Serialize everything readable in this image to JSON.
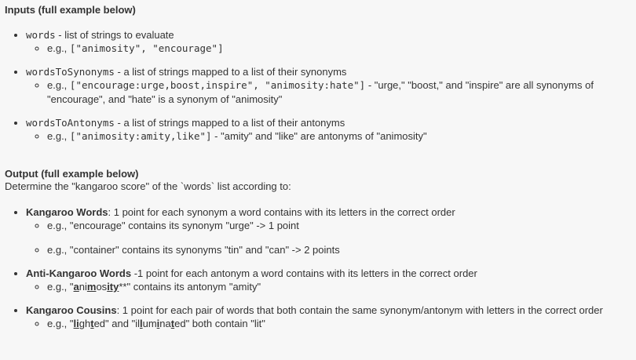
{
  "inputs": {
    "heading": "Inputs (full example below)",
    "items": [
      {
        "code": "words",
        "desc": " - list of strings to evaluate",
        "example_prefix": "e.g., ",
        "example_code": "[\"animosity\", \"encourage\"]",
        "example_suffix": ""
      },
      {
        "code": "wordsToSynonyms",
        "desc": " - a list of strings mapped to a list of their synonyms",
        "example_prefix": "e.g., ",
        "example_code": "[\"encourage:urge,boost,inspire\", \"animosity:hate\"]",
        "example_suffix": " - \"urge,\" \"boost,\" and \"inspire\" are all synonyms of \"encourage\", and \"hate\" is a synonym of \"animosity\""
      },
      {
        "code": "wordsToAntonyms",
        "desc": " - a list of strings mapped to a list of their antonyms",
        "example_prefix": "e.g., ",
        "example_code": "[\"animosity:amity,like\"]",
        "example_suffix": " - \"amity\" and \"like\" are antonyms of \"animosity\""
      }
    ]
  },
  "output": {
    "heading": "Output (full example below)",
    "description": "Determine the \"kangaroo score\" of the `words` list according to:",
    "kangaroo_words": {
      "title": "Kangaroo Words",
      "desc": ": 1 point for each synonym a word contains with its letters in the correct order",
      "ex1": "e.g., \"encourage\" contains its synonym \"urge\" -> 1 point",
      "ex2": "e.g., \"container\" contains its synonyms \"tin\" and \"can\" -> 2 points"
    },
    "anti_kangaroo": {
      "title": "Anti-Kangaroo Words",
      "desc": " -1 point for each antonym a word contains with its letters in the correct order",
      "ex_prefix": "e.g., \"",
      "ex_word_parts": [
        "a",
        "n",
        "i",
        "m",
        "os",
        "ity",
        "**"
      ],
      "ex_suffix": "\" contains its antonym \"amity\""
    },
    "cousins": {
      "title": "Kangaroo Cousins",
      "desc": ": 1 point for each pair of words that both contain the same synonym/antonym with letters in the correct order",
      "ex_prefix": "e.g., \"",
      "word1_parts": [
        "li",
        "gh",
        "t",
        "ed"
      ],
      "ex_mid": "\" and \"",
      "word2_parts": [
        "il",
        "l",
        "um",
        "i",
        "na",
        "t",
        "ed"
      ],
      "ex_suffix": "\" both contain \"lit\""
    }
  }
}
